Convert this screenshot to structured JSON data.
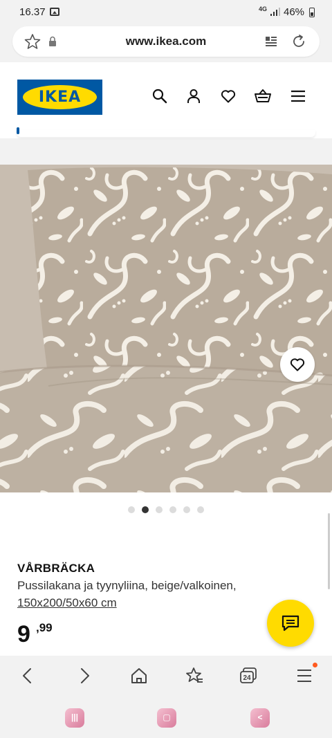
{
  "status_bar": {
    "time": "16.37",
    "network": "4G",
    "battery": "46%"
  },
  "browser": {
    "url": "www.ikea.com",
    "tab_count": "24"
  },
  "header": {
    "logo_text": "IKEA",
    "icons": [
      "search-icon",
      "account-icon",
      "heart-icon",
      "cart-icon",
      "menu-icon"
    ],
    "brand_blue": "#0058a3",
    "brand_yellow": "#ffdb00"
  },
  "product": {
    "name": "VÅRBRÄCKA",
    "description": "Pussilakana ja tyynyliina, beige/valkoinen,",
    "size": "150x200/50x60 cm",
    "price_main": "9",
    "price_decimals": ",99",
    "image_count": 6,
    "active_image_index": 1
  },
  "colors": {
    "fabric_beige": "#b9ac9c",
    "pattern_white": "#f4efe6"
  }
}
